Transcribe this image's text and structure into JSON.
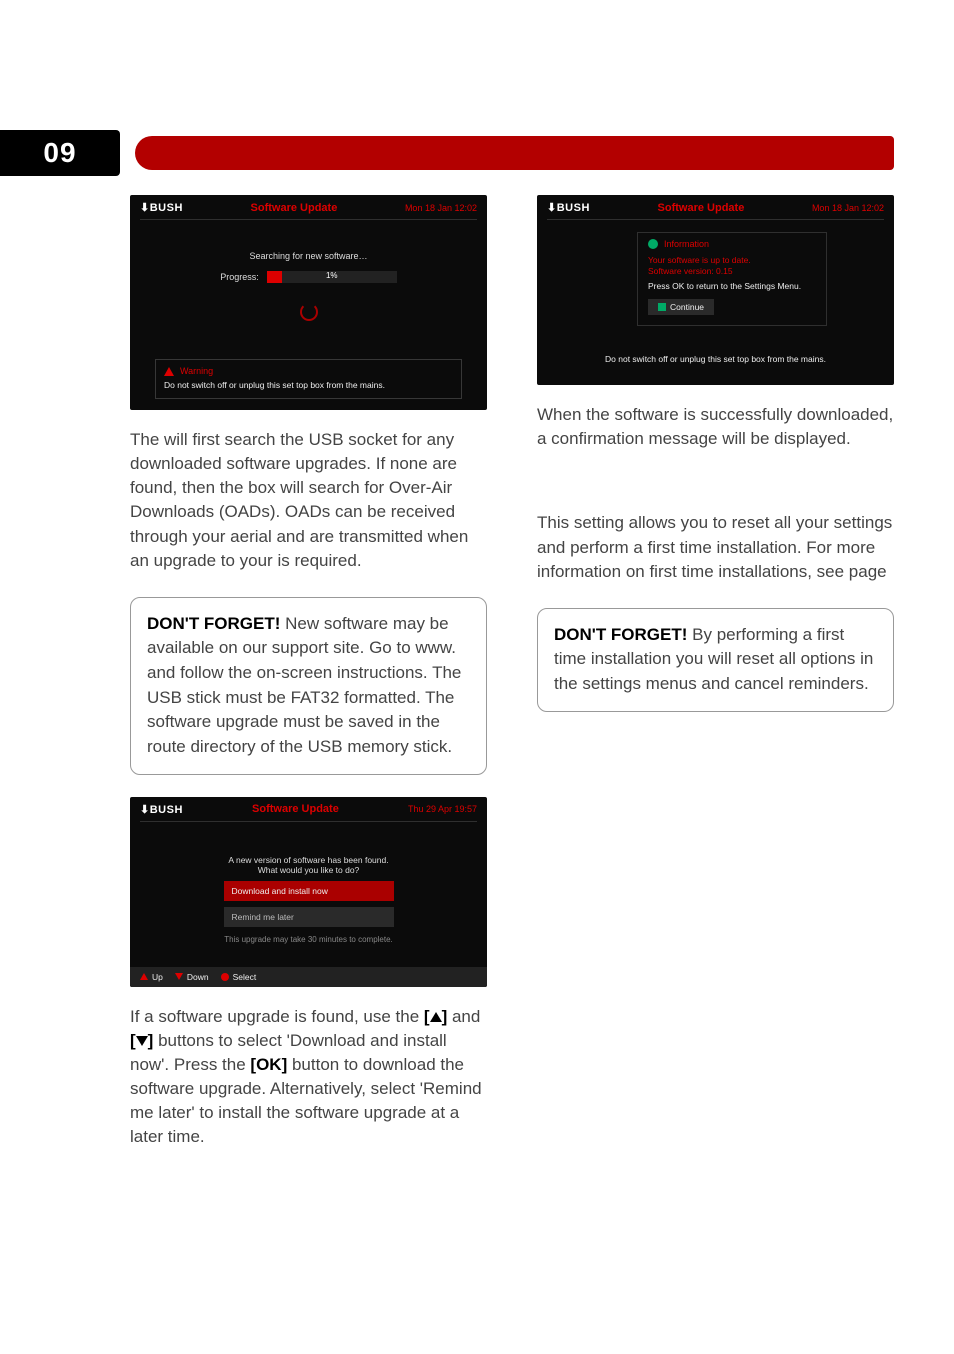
{
  "chapter": "09",
  "shotA": {
    "logo": "⬇BUSH",
    "title": "Software Update",
    "timestamp": "Mon 18 Jan 12:02",
    "searching": "Searching for new software…",
    "progress_label": "Progress:",
    "progress_value": "1%",
    "warning_title": "Warning",
    "warning_msg": "Do not switch off or unplug this set top box from the mains."
  },
  "para1_a": "The ",
  "para1_b": " will first search the USB socket for any downloaded software upgrades. If none are found, then the ",
  "para1_c": " box will search for Over-Air Downloads (OADs). OADs can be received through your aerial and are transmitted when an upgrade to your ",
  "para1_d": " is required.",
  "callout1_lead": "DON'T FORGET!",
  "callout1_body": " New software may be available on our support site. Go to www.",
  "callout1_body2": " and follow the on-screen instructions. The USB stick must be FAT32 formatted. The software upgrade must be saved in the route directory of the USB memory stick.",
  "shotB": {
    "logo": "⬇BUSH",
    "title": "Software Update",
    "timestamp": "Thu 29 Apr 19:57",
    "line1": "A new version of software has been found.",
    "line2": "What would you like to do?",
    "opt1": "Download and install now",
    "opt2": "Remind me later",
    "note": "This upgrade may take 30 minutes to complete.",
    "f_up": "Up",
    "f_down": "Down",
    "f_select": "Select"
  },
  "para2_a": "If a software upgrade is found, use the ",
  "para2_b": " and ",
  "para2_c": " buttons to select 'Download and install now'. Press the ",
  "para2_ok": "[OK]",
  "para2_d": " button to download the software upgrade. Alternatively, select 'Remind me later' to install the software upgrade at a later time.",
  "shotC": {
    "logo": "⬇BUSH",
    "title": "Software Update",
    "timestamp": "Mon 18 Jan 12:02",
    "info": "Information",
    "msg1": "Your software is up to date.",
    "msg1b": "Software version: 0.15",
    "msg2": "Press OK to return to the Settings Menu.",
    "btn": "Continue",
    "footer_warn": "Do not switch off or unplug this set top box from the mains."
  },
  "para3": "When the software is successfully downloaded, a confirmation message will be displayed.",
  "para4": "This setting allows you to reset all your settings and perform a first time installation. For more information on first time installations, see page ",
  "callout2_lead": "DON'T FORGET!",
  "callout2_body": " By performing a first time installation you will reset all options in the settings menus and cancel reminders.",
  "brackets": {
    "open": "[",
    "close": "]"
  }
}
